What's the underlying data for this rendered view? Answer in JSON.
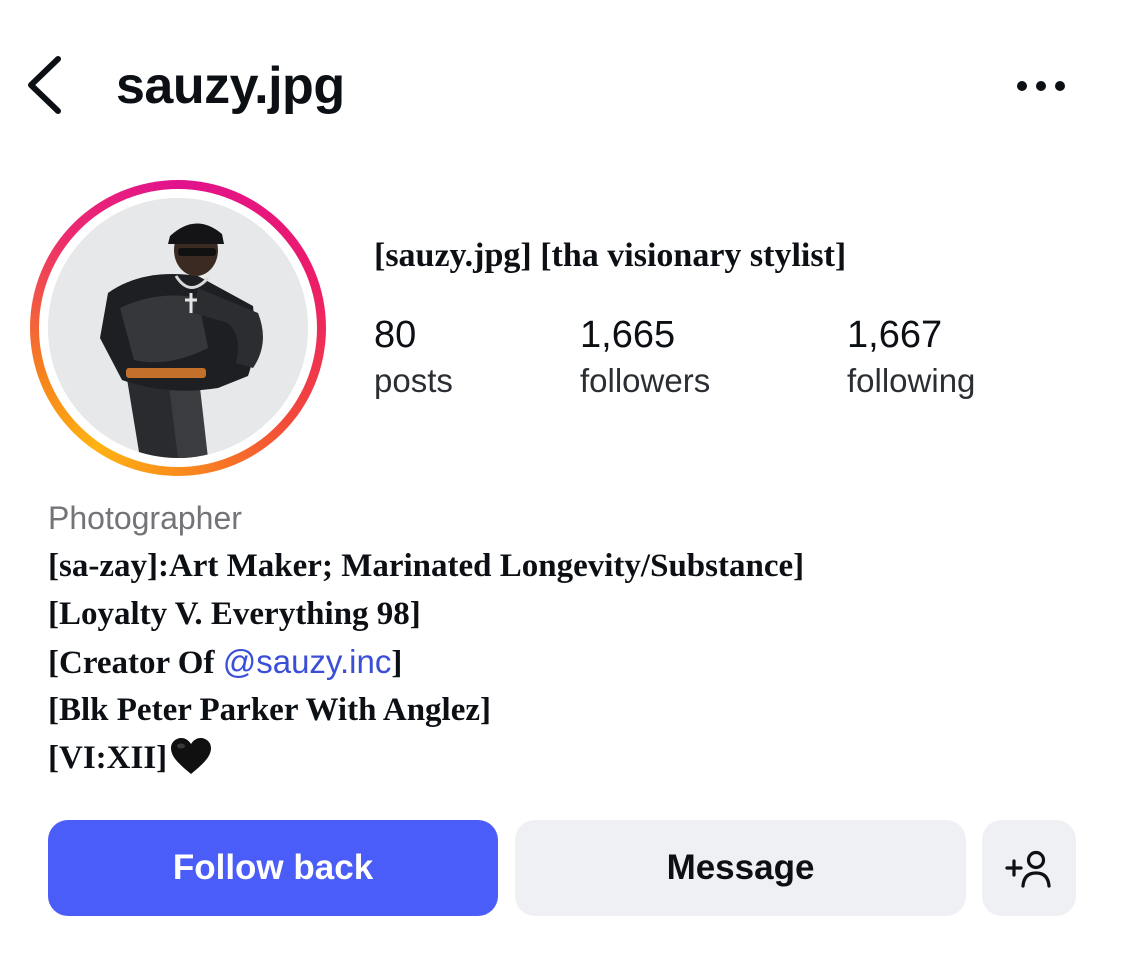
{
  "header": {
    "username": "sauzy.jpg",
    "back_icon": "chevron-left-icon",
    "more_icon": "more-horizontal-icon"
  },
  "profile": {
    "display_name": "[sauzy.jpg] [tha visionary stylist]",
    "stats": [
      {
        "value": "80",
        "label": "posts"
      },
      {
        "value": "1,665",
        "label": "followers"
      },
      {
        "value": "1,667",
        "label": "following"
      }
    ],
    "category": "Photographer",
    "bio": {
      "line1": "[sa-zay]:Art Maker; Marinated Longevity/Substance]",
      "line2": "[Loyalty V. Everything 98]",
      "line3_prefix": "[Creator Of ",
      "line3_link": "@sauzy.inc",
      "line3_suffix": "]",
      "line4": "[Blk Peter Parker With Anglez]",
      "line5": "[VI:XII]"
    }
  },
  "actions": {
    "follow_back": "Follow back",
    "message": "Message",
    "add_user_icon": "add-user-icon"
  },
  "colors": {
    "primary_button": "#4a5df9",
    "secondary_button": "#eff0f3",
    "link": "#3a4fd6",
    "muted_text": "#737378"
  }
}
